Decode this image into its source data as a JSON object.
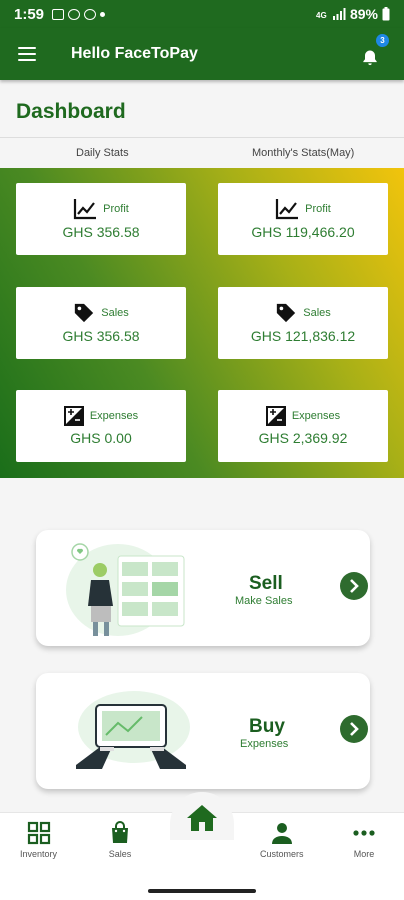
{
  "status_bar": {
    "time": "1:59",
    "battery": "89%"
  },
  "app_bar": {
    "title": "Hello FaceToPay",
    "notification_count": "3"
  },
  "dashboard": {
    "title": "Dashboard",
    "daily_header": "Daily Stats",
    "monthly_header": "Monthly's Stats(May)"
  },
  "stats": {
    "daily": {
      "profit_label": "Profit",
      "profit_value": "GHS 356.58",
      "sales_label": "Sales",
      "sales_value": "GHS 356.58",
      "expenses_label": "Expenses",
      "expenses_value": "GHS 0.00"
    },
    "monthly": {
      "profit_label": "Profit",
      "profit_value": "GHS 119,466.20",
      "sales_label": "Sales",
      "sales_value": "GHS 121,836.12",
      "expenses_label": "Expenses",
      "expenses_value": "GHS 2,369.92"
    }
  },
  "actions": {
    "sell_title": "Sell",
    "sell_subtitle": "Make Sales",
    "buy_title": "Buy",
    "buy_subtitle": "Expenses"
  },
  "bottom_nav": {
    "inventory": "Inventory",
    "sales": "Sales",
    "customers": "Customers",
    "more": "More"
  },
  "colors": {
    "primary": "#1f6a1f",
    "accent_yellow": "#f2c40c",
    "text_green": "#2e7d32"
  }
}
